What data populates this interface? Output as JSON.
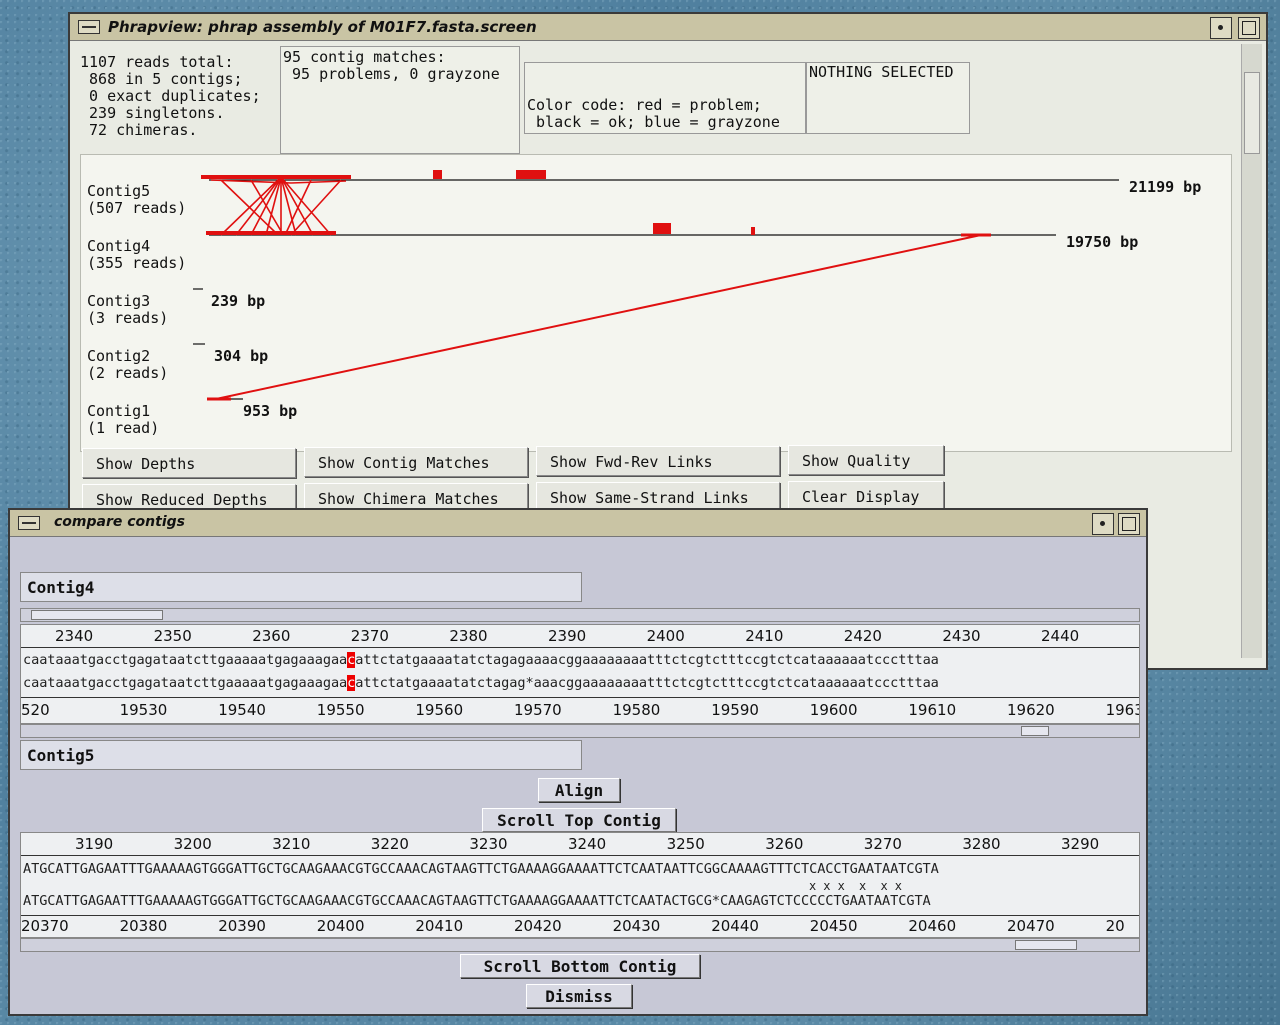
{
  "main": {
    "title": "Phrapview: phrap assembly of M01F7.fasta.screen",
    "summary": "1107 reads total:\n 868 in 5 contigs;\n 0 exact duplicates;\n 239 singletons.\n 72 chimeras.",
    "matches": "95 contig matches:\n 95 problems, 0 grayzone",
    "colorcode": "Color code: red = problem;\n black = ok; blue = grayzone",
    "selection": "NOTHING SELECTED",
    "contigs": [
      {
        "label": "Contig5\n(507 reads)",
        "bp": "21199 bp"
      },
      {
        "label": "Contig4\n(355 reads)",
        "bp": "19750 bp"
      },
      {
        "label": "Contig3\n(3 reads)",
        "bp": "239 bp"
      },
      {
        "label": "Contig2\n(2 reads)",
        "bp": "304 bp"
      },
      {
        "label": "Contig1\n(1 read)",
        "bp": "953 bp"
      }
    ],
    "buttons": {
      "show_depths": "Show Depths",
      "show_contig_matches": "Show Contig Matches",
      "show_fwd_rev_links": "Show Fwd-Rev Links",
      "show_quality": "Show Quality",
      "show_reduced_depths": "Show Reduced Depths",
      "show_chimera_matches": "Show Chimera Matches",
      "show_same_strand_links": "Show Same-Strand Links",
      "clear_display": "Clear Display"
    },
    "colors": {
      "problem": "#e01010",
      "ok": "#000000",
      "grayzone": "#2040c0"
    }
  },
  "compare": {
    "title": "compare contigs",
    "top_contig": "Contig4",
    "bottom_contig": "Contig5",
    "top_ticks_upper": [
      "2340",
      "2350",
      "2360",
      "2370",
      "2380",
      "2390",
      "2400",
      "2410",
      "2420",
      "2430",
      "2440"
    ],
    "top_seq1": "caataaatgacctgagataatcttgaaaaatgagaaagaacattctatgaaaatatctagagaaaacggaaaaaaaatttctcgtctttccgtctcataaaaaatccctttaa",
    "top_seq2": "caataaatgacctgagataatcttgaaaaatgagaaagaacattctatgaaaatatctagag*aaacggaaaaaaaatttctcgtctttccgtctcataaaaaatccctttaa",
    "top_ticks_lower": [
      "520",
      "19530",
      "19540",
      "19550",
      "19560",
      "19570",
      "19580",
      "19590",
      "19600",
      "19610",
      "19620",
      "1963"
    ],
    "align_label": "Align",
    "scroll_top_label": "Scroll Top Contig",
    "bottom_ticks_upper": [
      "3190",
      "3200",
      "3210",
      "3220",
      "3230",
      "3240",
      "3250",
      "3260",
      "3270",
      "3280",
      "3290"
    ],
    "bottom_seq1": "ATGCATTGAGAATTTGAAAAAGTGGGATTGCTGCAAGAAACGTGCCAAACAGTAAGTTCTGAAAAGGAAAATTCTCAATAATTCGGCAAAAGTTTCTCACCTGAATAATCGTA",
    "bottom_seq2": "ATGCATTGAGAATTTGAAAAAGTGGGATTGCTGCAAGAAACGTGCCAAACAGTAAGTTCTGAAAAGGAAAATTCTCAATACTGCG*CAAGAGTCTCCCCCTGAATAATCGTA",
    "mismatch_marks": "x x x  x  x x",
    "bottom_ticks_lower": [
      "20370",
      "20380",
      "20390",
      "20400",
      "20410",
      "20420",
      "20430",
      "20440",
      "20450",
      "20460",
      "20470",
      "20"
    ],
    "scroll_bottom_label": "Scroll Bottom Contig",
    "dismiss_label": "Dismiss"
  }
}
